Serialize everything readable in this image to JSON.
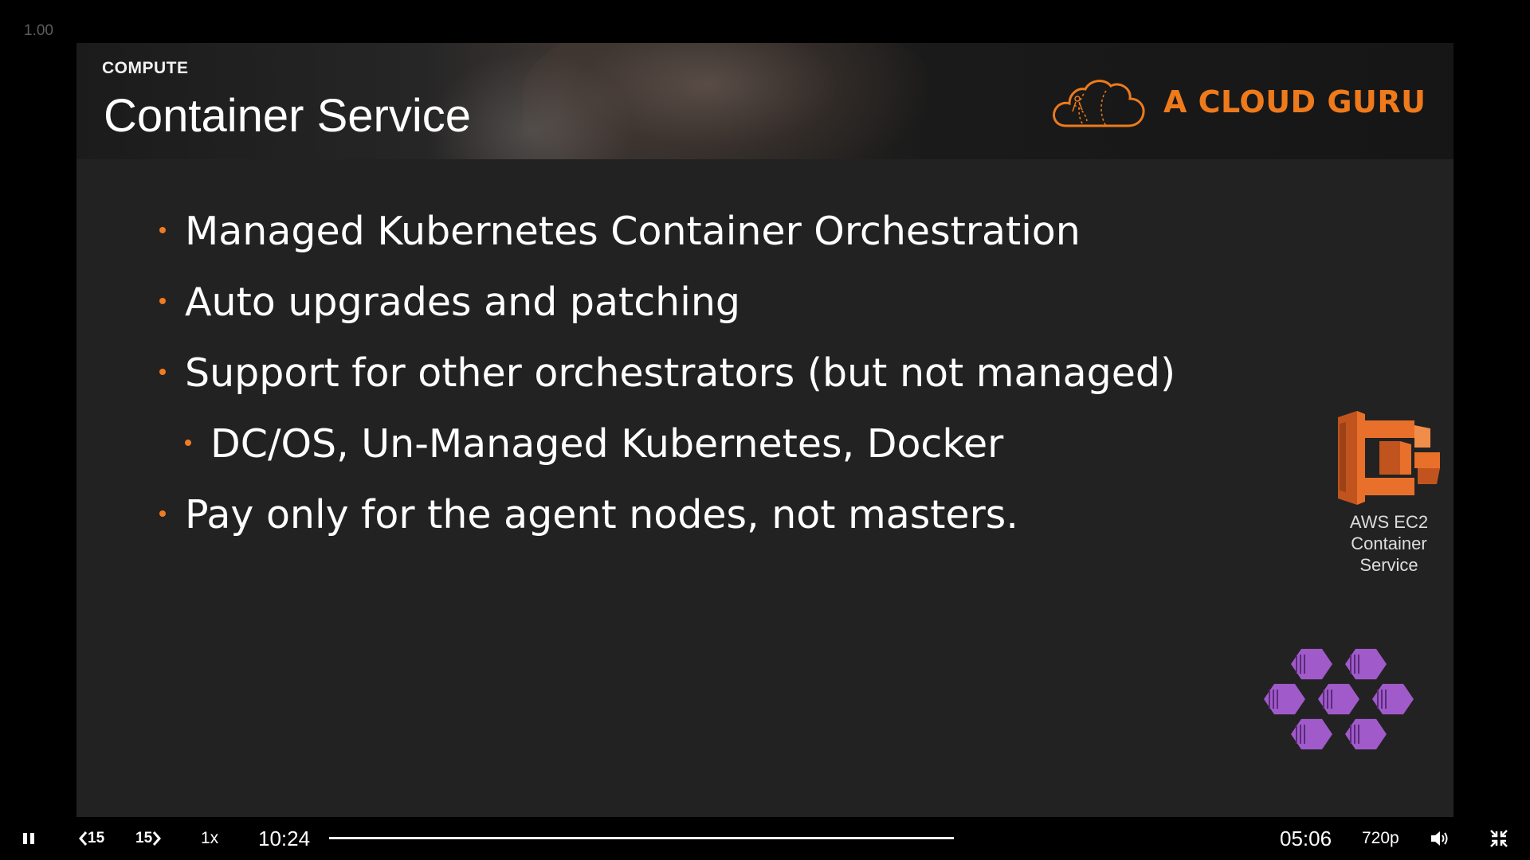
{
  "zoom_readout": "1.00",
  "slide": {
    "category": "COMPUTE",
    "title": "Container Service",
    "brand": {
      "name": "A CLOUD GURU",
      "logo_icon": "cloud-logo-icon",
      "color": "#ee7a1c"
    },
    "bullets": [
      {
        "text": "Managed Kubernetes Container Orchestration",
        "level": 1
      },
      {
        "text": "Auto upgrades and patching",
        "level": 1
      },
      {
        "text": "Support for other orchestrators (but not managed)",
        "level": 1
      },
      {
        "text": "DC/OS, Un-Managed Kubernetes, Docker",
        "level": 2
      },
      {
        "text": "Pay only for the agent nodes, not masters.",
        "level": 1
      }
    ],
    "bullet_color": "#ef7b22",
    "ecs": {
      "icon": "aws-ecs-icon",
      "caption": [
        "AWS EC2",
        "Container",
        "Service"
      ],
      "color": "#e8702a"
    },
    "aks": {
      "icon": "azure-container-service-icon",
      "color": "#a05ac9"
    }
  },
  "player": {
    "play_pause_icon": "pause-icon",
    "rewind_label": "15",
    "forward_label": "15",
    "speed": "1x",
    "elapsed": "10:24",
    "remaining": "05:06",
    "quality": "720p",
    "volume_icon": "volume-icon",
    "exit_fullscreen_icon": "exit-fullscreen-icon"
  }
}
